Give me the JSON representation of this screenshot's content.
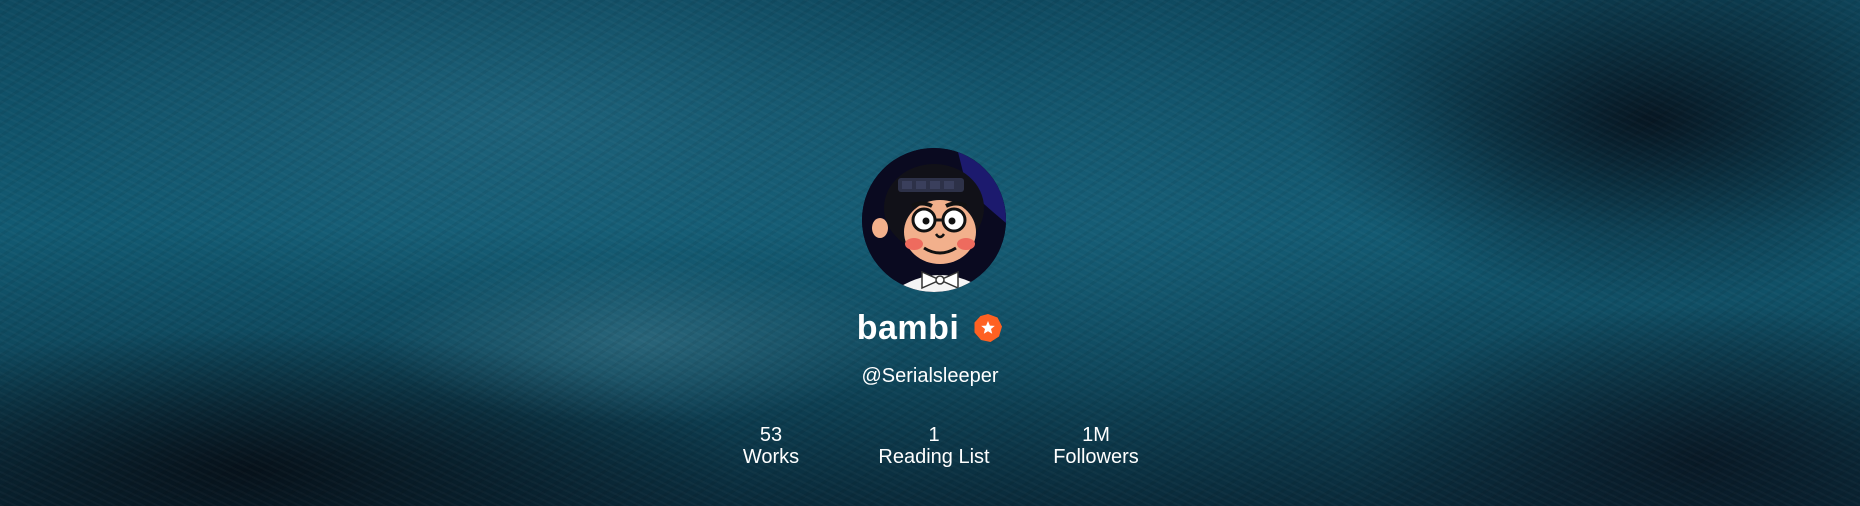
{
  "profile": {
    "display_name": "bambi",
    "handle": "@Serialsleeper",
    "badge_icon": "star-badge-icon",
    "badge_color": "#ff6122",
    "avatar_icon": "cartoon-avatar"
  },
  "stats": [
    {
      "value": "53",
      "label": "Works"
    },
    {
      "value": "1",
      "label": "Reading List"
    },
    {
      "value": "1M",
      "label": "Followers"
    }
  ],
  "colors": {
    "background": "#125a72",
    "text": "#ffffff"
  }
}
